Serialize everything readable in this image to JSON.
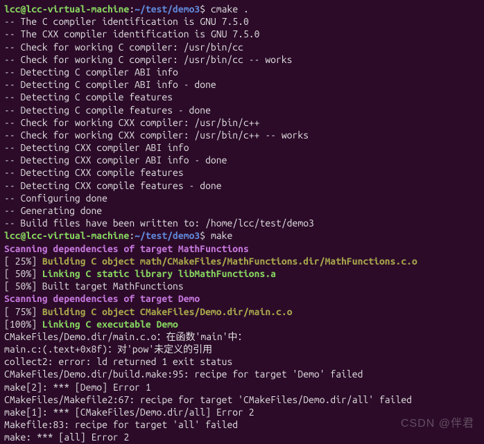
{
  "prompt1": {
    "user": "lcc@lcc-virtual-machine",
    "sep1": ":",
    "path": "~/test/demo3",
    "sep2": "$ ",
    "cmd": "cmake ."
  },
  "cmake": {
    "l01": "-- The C compiler identification is GNU 7.5.0",
    "l02": "-- The CXX compiler identification is GNU 7.5.0",
    "l03": "-- Check for working C compiler: /usr/bin/cc",
    "l04": "-- Check for working C compiler: /usr/bin/cc -- works",
    "l05": "-- Detecting C compiler ABI info",
    "l06": "-- Detecting C compiler ABI info - done",
    "l07": "-- Detecting C compile features",
    "l08": "-- Detecting C compile features - done",
    "l09": "-- Check for working CXX compiler: /usr/bin/c++",
    "l10": "-- Check for working CXX compiler: /usr/bin/c++ -- works",
    "l11": "-- Detecting CXX compiler ABI info",
    "l12": "-- Detecting CXX compiler ABI info - done",
    "l13": "-- Detecting CXX compile features",
    "l14": "-- Detecting CXX compile features - done",
    "l15": "-- Configuring done",
    "l16": "-- Generating done",
    "l17": "-- Build files have been written to: /home/lcc/test/demo3"
  },
  "prompt2": {
    "user": "lcc@lcc-virtual-machine",
    "sep1": ":",
    "path": "~/test/demo3",
    "sep2": "$ ",
    "cmd": "make"
  },
  "make": {
    "scan1": "Scanning dependencies of target MathFunctions",
    "p25a": "[ 25%] ",
    "p25b": "Building C object math/CMakeFiles/MathFunctions.dir/MathFunctions.c.o",
    "p50a": "[ 50%] ",
    "p50b": "Linking C static library libMathFunctions.a",
    "built1": "[ 50%] Built target MathFunctions",
    "scan2": "Scanning dependencies of target Demo",
    "p75a": "[ 75%] ",
    "p75b": "Building C object CMakeFiles/Demo.dir/main.c.o",
    "p100a": "[100%] ",
    "p100b": "Linking C executable Demo",
    "err1": "CMakeFiles/Demo.dir/main.c.o：在函数'main'中：",
    "err2": "main.c:(.text+0x8f)：对'pow'未定义的引用",
    "err3": "collect2: error: ld returned 1 exit status",
    "err4": "CMakeFiles/Demo.dir/build.make:95: recipe for target 'Demo' failed",
    "err5": "make[2]: *** [Demo] Error 1",
    "err6": "CMakeFiles/Makefile2:67: recipe for target 'CMakeFiles/Demo.dir/all' failed",
    "err7": "make[1]: *** [CMakeFiles/Demo.dir/all] Error 2",
    "err8": "Makefile:83: recipe for target 'all' failed",
    "err9": "make: *** [all] Error 2"
  },
  "watermark": "CSDN @伴君"
}
